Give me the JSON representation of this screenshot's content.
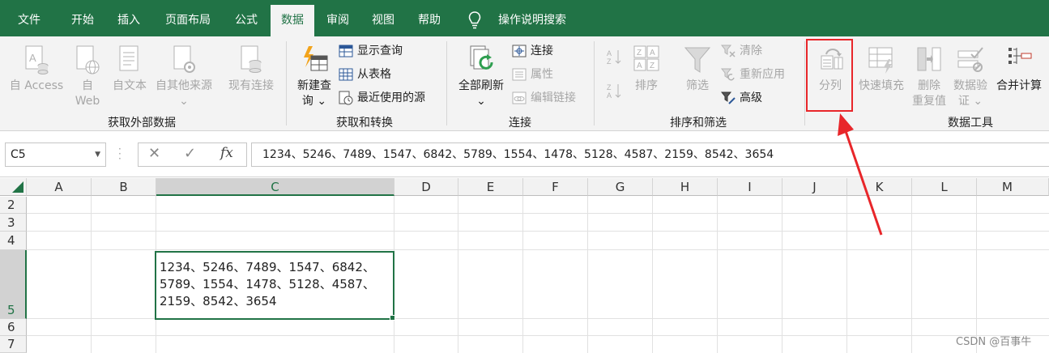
{
  "tabs": [
    "文件",
    "开始",
    "插入",
    "页面布局",
    "公式",
    "数据",
    "审阅",
    "视图",
    "帮助"
  ],
  "active_tab": "数据",
  "tell_me": "操作说明搜索",
  "ribbon": {
    "get_external": {
      "label": "获取外部数据",
      "from_access": "自 Access",
      "from_web_1": "自",
      "from_web_2": "Web",
      "from_text": "自文本",
      "from_other": "自其他来源",
      "from_other_arrow": "⌄",
      "existing": "现有连接"
    },
    "get_transform": {
      "label": "获取和转换",
      "new_query_1": "新建查",
      "new_query_2": "询 ⌄",
      "show_queries": "显示查询",
      "from_table": "从表格",
      "recent_sources": "最近使用的源"
    },
    "connections": {
      "label": "连接",
      "refresh_all": "全部刷新",
      "refresh_arrow": "⌄",
      "connections": "连接",
      "properties": "属性",
      "edit_links": "编辑链接"
    },
    "sort_filter": {
      "label": "排序和筛选",
      "sort": "排序",
      "filter": "筛选",
      "clear": "清除",
      "reapply": "重新应用",
      "advanced": "高级"
    },
    "data_tools": {
      "label": "数据工具",
      "text_to_columns": "分列",
      "flash_fill": "快速填充",
      "remove_dup_1": "删除",
      "remove_dup_2": "重复值",
      "validation_1": "数据验",
      "validation_2": "证 ⌄",
      "consolidate": "合并计算"
    }
  },
  "name_box": "C5",
  "formula_cancel": "✕",
  "formula_enter": "✓",
  "formula_fx": "fx",
  "formula": "1234、5246、7489、1547、6842、5789、1554、1478、5128、4587、2159、8542、3654",
  "columns": [
    "A",
    "B",
    "C",
    "D",
    "E",
    "F",
    "G",
    "H",
    "I",
    "J",
    "K",
    "L",
    "M"
  ],
  "rows": [
    "2",
    "3",
    "4",
    "5",
    "6",
    "7"
  ],
  "selected_cell": "C5",
  "cell_c5_lines": [
    "1234、5246、7489、1547、6842、",
    "5789、1554、1478、5128、4587、",
    "2159、8542、3654"
  ],
  "watermark": "CSDN @百事牛",
  "colors": {
    "accent": "#217346",
    "highlight": "#e8262a"
  }
}
